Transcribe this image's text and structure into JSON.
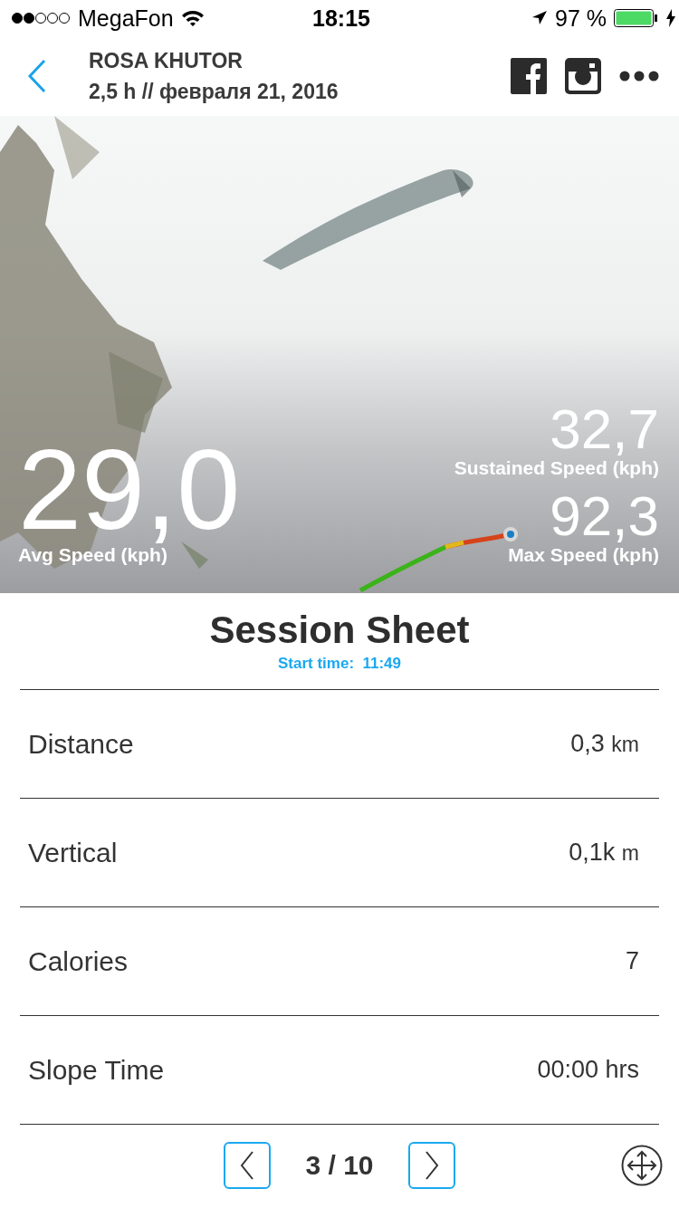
{
  "status_bar": {
    "carrier": "MegaFon",
    "time": "18:15",
    "battery": "97 %"
  },
  "header": {
    "title": "ROSA KHUTOR",
    "subtitle": "2,5 h // февраля 21, 2016"
  },
  "map": {
    "stats": [
      {
        "kind": "big",
        "value": "29,0",
        "label": "Avg Speed (kph)"
      },
      {
        "kind": "small",
        "value": "32,7",
        "label": "Sustained Speed (kph)"
      },
      {
        "kind": "small",
        "value": "92,3",
        "label": "Max Speed (kph)"
      }
    ]
  },
  "sheet": {
    "title": "Session Sheet",
    "start_label": "Start time:",
    "start_time": "11:49",
    "rows": [
      {
        "label": "Distance",
        "value": "0,3",
        "unit": "km"
      },
      {
        "label": "Vertical",
        "value": "0,1k",
        "unit": "m"
      },
      {
        "label": "Calories",
        "value": "7"
      },
      {
        "label": "Slope Time",
        "value": "00:00 hrs"
      }
    ]
  },
  "pager": {
    "text": "3 / 10"
  }
}
